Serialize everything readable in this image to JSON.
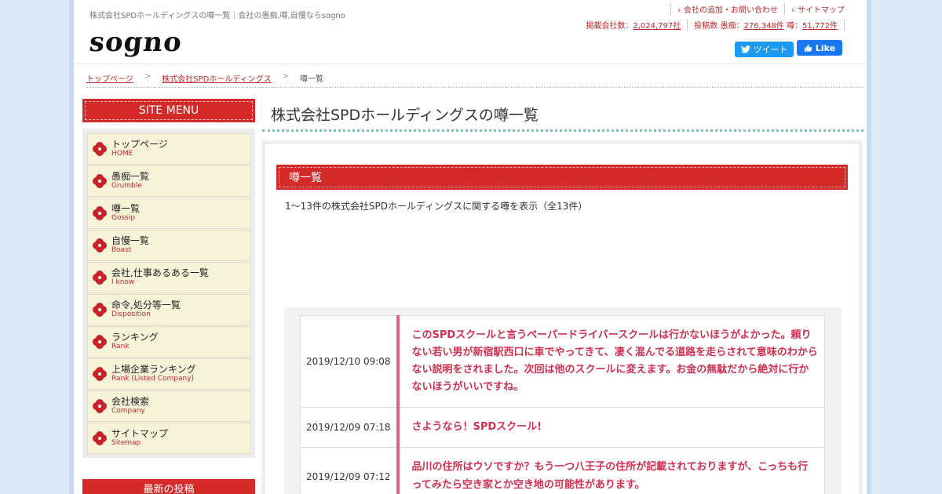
{
  "header": {
    "tagline": "株式会社SPDホールディングスの噂一覧｜会社の愚痴,噂,自慢ならsogno",
    "logo": "sogno",
    "top_links": [
      "会社の追加・お問い合わせ",
      "サイトマップ"
    ],
    "stats": {
      "companies_label": "掲載会社数：",
      "companies_value": "2,024,797社",
      "posts_label": "投稿数 愚痴：",
      "grumble_value": "276,348件",
      "gossip_label": " 噂：",
      "gossip_value": "51,772件"
    },
    "tweet_label": "ツイート",
    "like_label": "Like"
  },
  "breadcrumb": {
    "items": [
      "トップページ",
      "株式会社SPDホールディングス",
      "噂一覧"
    ],
    "separator": ">"
  },
  "sidebar": {
    "title": "SITE MENU",
    "items": [
      {
        "ja": "トップページ",
        "en": "HOME"
      },
      {
        "ja": "愚痴一覧",
        "en": "Grumble"
      },
      {
        "ja": "噂一覧",
        "en": "Gossip"
      },
      {
        "ja": "自慢一覧",
        "en": "Boast"
      },
      {
        "ja": "会社,仕事あるある一覧",
        "en": "I know"
      },
      {
        "ja": "命令,処分等一覧",
        "en": "Disposition"
      },
      {
        "ja": "ランキング",
        "en": "Rank"
      },
      {
        "ja": "上場企業ランキング",
        "en": "Rank (Listed Company)"
      },
      {
        "ja": "会社検索",
        "en": "Company"
      },
      {
        "ja": "サイトマップ",
        "en": "Sitemap"
      }
    ],
    "latest_title": "最新の投稿"
  },
  "main": {
    "title": "株式会社SPDホールディングスの噂一覧",
    "section_title": "噂一覧",
    "count_text": "1～13件の株式会社SPDホールディングスに関する噂を表示（全13件）",
    "posts": [
      {
        "date": "2019/12/10 09:08",
        "text": "このSPDスクールと言うペーパードライバースクールは行かないほうがよかった。頼りない若い男が新宿駅西口に車でやってきて、凄く混んでる道路を走らされて意味のわからない説明をされました。次回は他のスクールに変えます。お金の無駄だから絶対に行かないほうがいいですね。"
      },
      {
        "date": "2019/12/09 07:18",
        "text": "さようなら！SPDスクール!"
      },
      {
        "date": "2019/12/09 07:12",
        "text": "品川の住所はウソですか？もう一つ八王子の住所が記載されておりますが、こっちも行ってみたら空き家とか空き地の可能性があります。"
      }
    ]
  },
  "colors": {
    "accent_red": "#d42a2a",
    "link_red": "#c0282c",
    "post_pink": "#d03050",
    "menu_bg": "#f6f3d9",
    "page_bg": "#dce9f7"
  }
}
